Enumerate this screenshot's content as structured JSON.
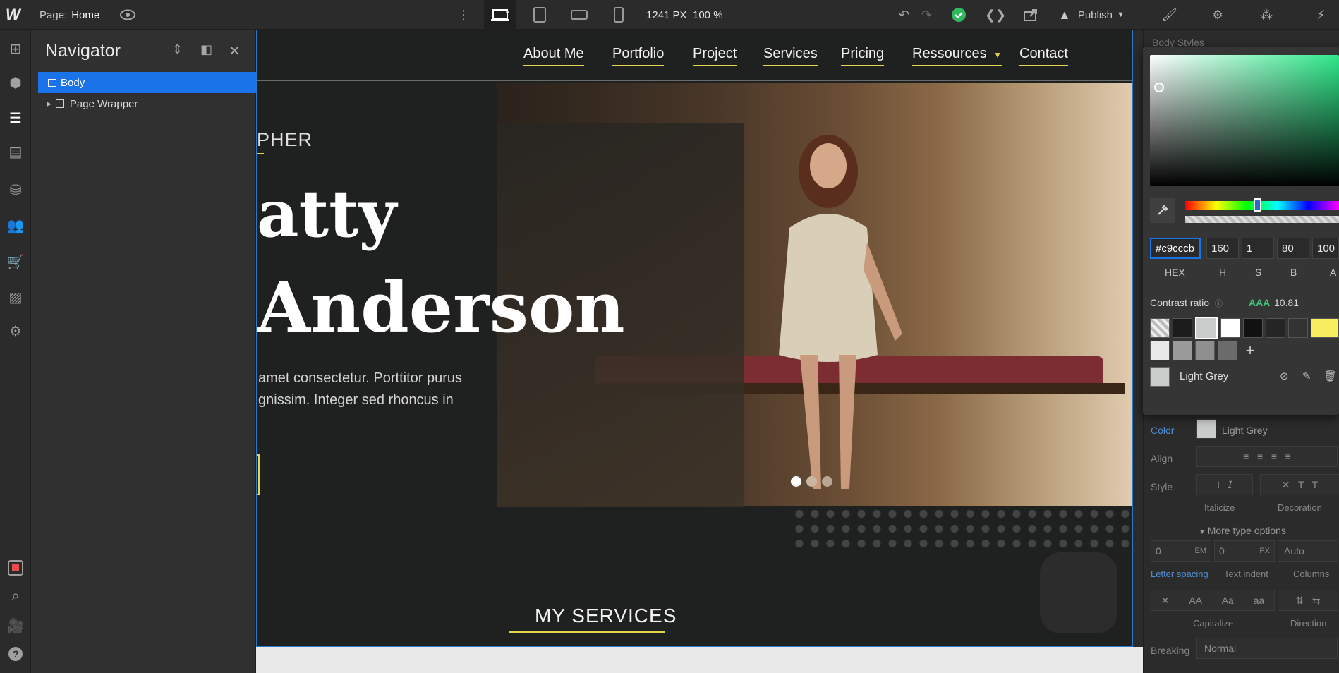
{
  "topbar": {
    "logo": "W",
    "page_prefix": "Page:",
    "page_name": "Home",
    "width_value": "1241 PX",
    "zoom_value": "100 %",
    "publish_label": "Publish"
  },
  "navigator": {
    "title": "Navigator",
    "tree": [
      {
        "label": "Body",
        "selected": true
      },
      {
        "label": "Page Wrapper",
        "selected": false
      }
    ]
  },
  "site": {
    "nav_links": [
      "About Me",
      "Portfolio",
      "Project",
      "Services",
      "Pricing",
      "Ressources",
      "Contact"
    ],
    "eyebrow": "PHER",
    "heading_line1": "atty",
    "heading_line2": "Anderson",
    "para_line1": "amet consectetur. Porttitor purus",
    "para_line2": "gnissim. Integer sed rhoncus in",
    "services_title": "MY SERVICES"
  },
  "color_picker": {
    "hex": "#c9cccb",
    "h": "160",
    "s": "1",
    "b": "80",
    "a": "100",
    "labels": {
      "hex": "HEX",
      "h": "H",
      "s": "S",
      "b": "B",
      "a": "A"
    },
    "contrast_label": "Contrast ratio",
    "contrast_grade": "AAA",
    "contrast_value": "10.81",
    "swatch_name": "Light Grey",
    "accent": "#2ee889"
  },
  "style_panel": {
    "section_title": "Body Styles",
    "color_label": "Color",
    "color_value": "Light Grey",
    "align_label": "Align",
    "style_label": "Style",
    "italicize_label": "Italicize",
    "decoration_label": "Decoration",
    "more_type_options": "More type options",
    "letter_spacing_value": "0",
    "letter_spacing_unit": "EM",
    "text_indent_value": "0",
    "text_indent_unit": "PX",
    "columns_value": "Auto",
    "letter_spacing_label": "Letter spacing",
    "text_indent_label": "Text indent",
    "columns_label": "Columns",
    "capitalize_label": "Capitalize",
    "direction_label": "Direction",
    "breaking_label": "Breaking",
    "breaking_value": "Normal",
    "cap_options": [
      "AA",
      "Aa",
      "aa"
    ]
  }
}
